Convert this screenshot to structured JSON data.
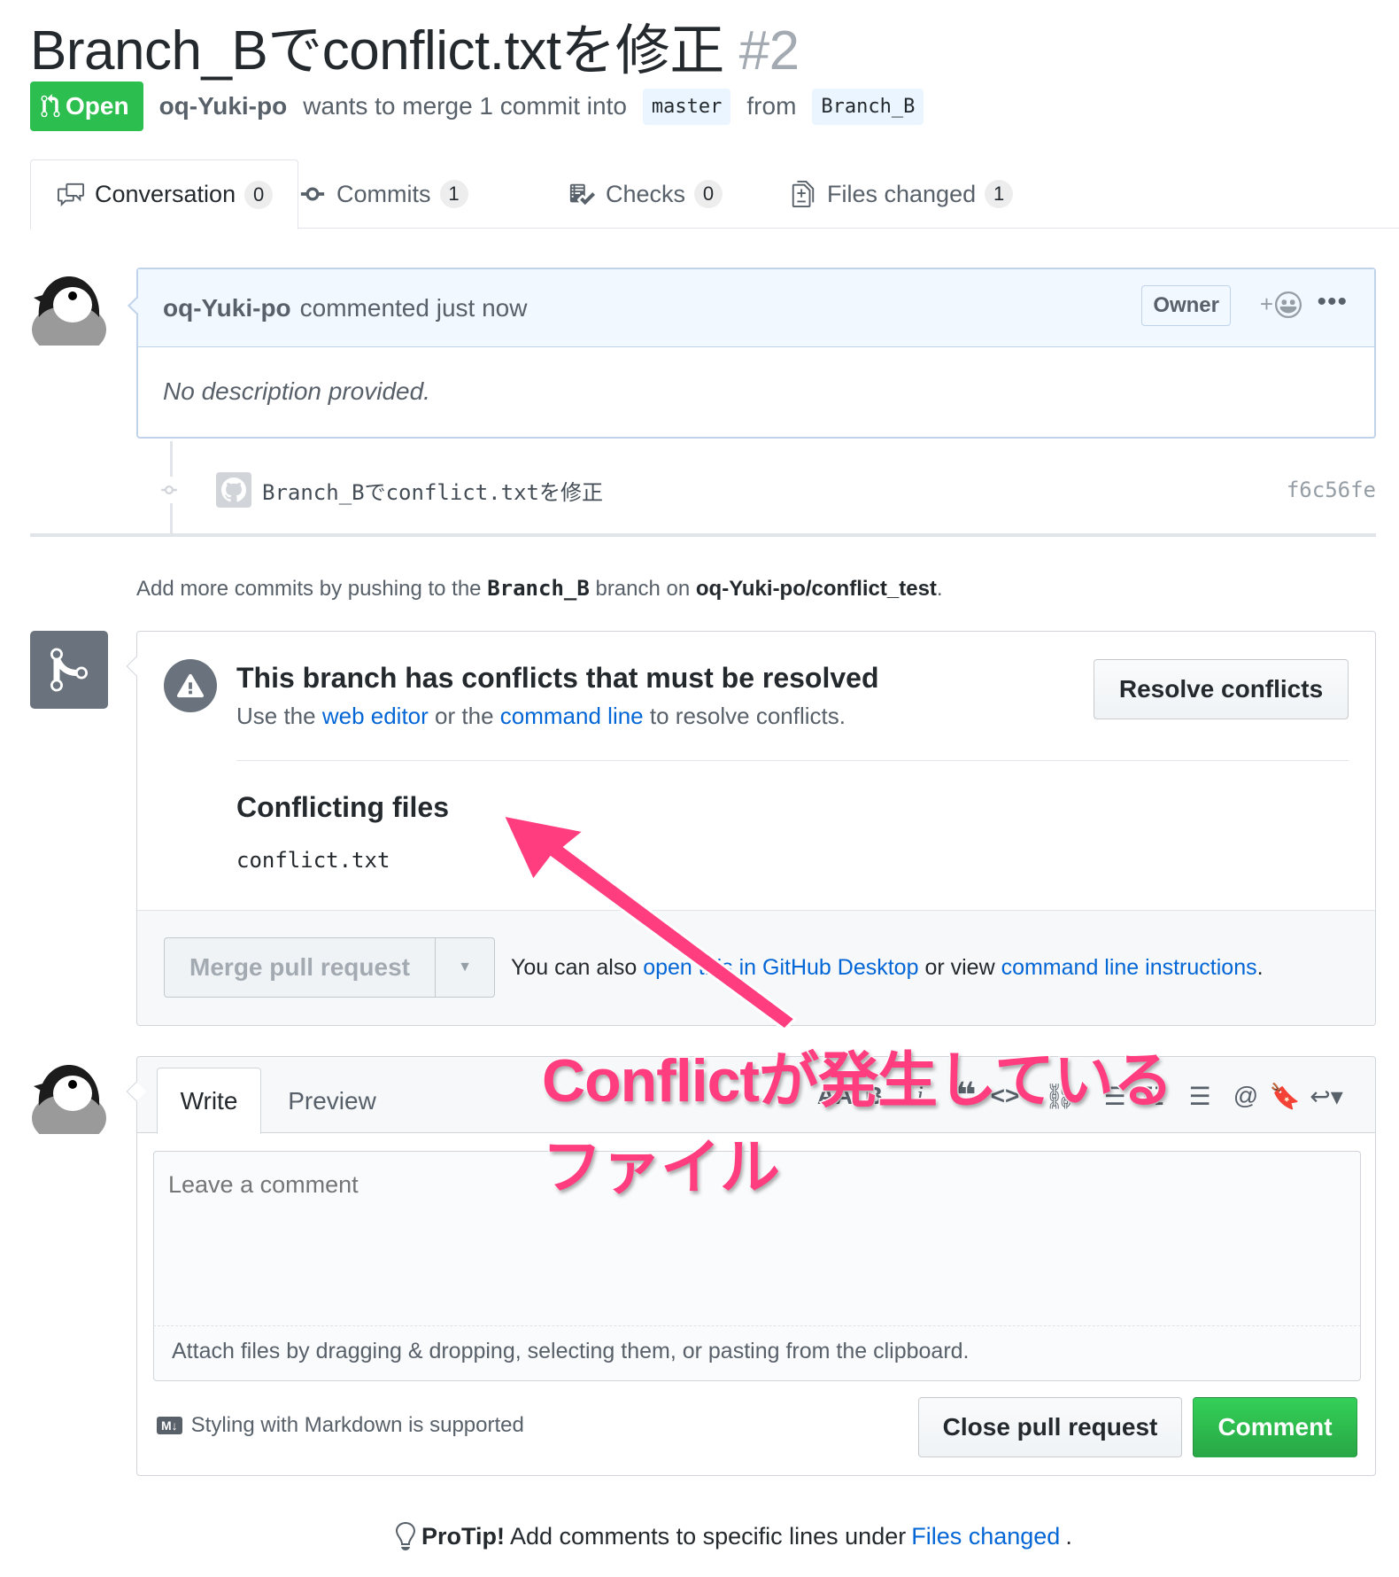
{
  "pr": {
    "title": "Branch_Bでconflict.txtを修正",
    "number": "#2",
    "state": "Open",
    "author": "oq-Yuki-po",
    "merge_text": "wants to merge 1 commit into",
    "base_branch": "master",
    "from_text": "from",
    "head_branch": "Branch_B"
  },
  "tabs": [
    {
      "label": "Conversation",
      "count": "0",
      "icon": "comment-discussion-icon"
    },
    {
      "label": "Commits",
      "count": "1",
      "icon": "git-commit-icon"
    },
    {
      "label": "Checks",
      "count": "0",
      "icon": "checklist-icon"
    },
    {
      "label": "Files changed",
      "count": "1",
      "icon": "diff-icon"
    }
  ],
  "comment": {
    "author": "oq-Yuki-po",
    "action": "commented just now",
    "badge": "Owner",
    "body": "No description provided."
  },
  "commit": {
    "message": "Branch_Bでconflict.txtを修正",
    "sha": "f6c56fe"
  },
  "add_more": {
    "prefix": "Add more commits by pushing to the",
    "branch": "Branch_B",
    "middle": "branch on",
    "repo": "oq-Yuki-po/conflict_test",
    "suffix": "."
  },
  "merge": {
    "title": "This branch has conflicts that must be resolved",
    "sub_prefix": "Use the",
    "web_editor": "web editor",
    "sub_middle": "or the",
    "command_line": "command line",
    "sub_suffix": "to resolve conflicts.",
    "resolve_button": "Resolve conflicts",
    "conflicting_title": "Conflicting files",
    "files": [
      "conflict.txt"
    ],
    "merge_button": "Merge pull request",
    "note_prefix": "You can also",
    "desktop_link": "open this in GitHub Desktop",
    "note_middle": "or view",
    "cli_link": "command line instructions",
    "note_suffix": "."
  },
  "write": {
    "tab_write": "Write",
    "tab_preview": "Preview",
    "placeholder": "Leave a comment",
    "attach": "Attach files by dragging & dropping, selecting them, or pasting from the clipboard.",
    "markdown_badge": "M↓",
    "markdown_note": "Styling with Markdown is supported",
    "close_button": "Close pull request",
    "comment_button": "Comment"
  },
  "protip": {
    "bold": "ProTip!",
    "text": "Add comments to specific lines under",
    "link": "Files changed",
    "suffix": "."
  },
  "annotation": {
    "line1": "Conflictが発生している",
    "line2": "ファイル",
    "color": "#ff3d7f"
  },
  "colors": {
    "open_green": "#2cbe4e",
    "link_blue": "#0366d6",
    "comment_green": "#28a745"
  }
}
